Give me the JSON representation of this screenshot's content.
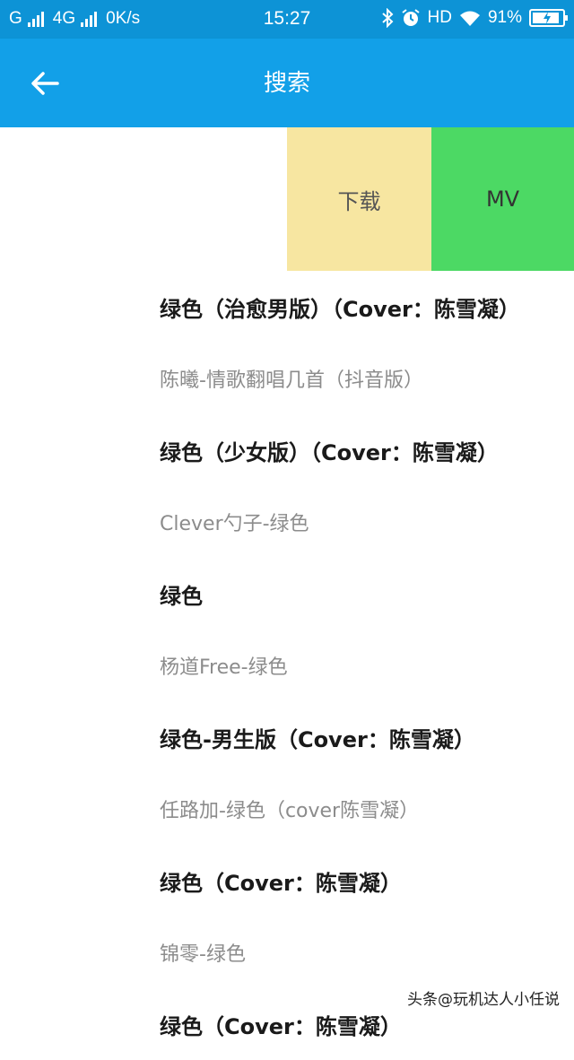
{
  "status_bar": {
    "carrier": "G",
    "network": "4G",
    "speed": "0K/s",
    "time": "15:27",
    "hd": "HD",
    "battery": "91%",
    "battery_level": 0.91,
    "icons": [
      "signal-icon",
      "bluetooth-icon",
      "alarm-icon",
      "wifi-icon",
      "battery-icon"
    ]
  },
  "app_bar": {
    "title": "搜索",
    "back_icon": "arrow-left-icon"
  },
  "swipe_actions": {
    "download_label": "下载",
    "mv_label": "MV",
    "download_color": "#f7e6a1",
    "mv_color": "#4cd964"
  },
  "results": [
    {
      "type": "song",
      "text": "绿色（治愈男版）（Cover：陈雪凝）"
    },
    {
      "type": "artist",
      "text": "陈曦-情歌翻唱几首（抖音版）"
    },
    {
      "type": "song",
      "text": "绿色（少女版）（Cover：陈雪凝）"
    },
    {
      "type": "artist",
      "text": "Clever勺子-绿色"
    },
    {
      "type": "song",
      "text": "绿色"
    },
    {
      "type": "artist",
      "text": "杨道Free-绿色"
    },
    {
      "type": "song",
      "text": "绿色-男生版（Cover：陈雪凝）"
    },
    {
      "type": "artist",
      "text": "任路加-绿色（cover陈雪凝）"
    },
    {
      "type": "song",
      "text": "绿色（Cover：陈雪凝）"
    },
    {
      "type": "artist",
      "text": "锦零-绿色"
    },
    {
      "type": "song",
      "text": "绿色（Cover：陈雪凝）"
    }
  ],
  "watermark": "头条@玩机达人小任说",
  "colors": {
    "status_bar": "#0d93d6",
    "app_bar": "#12a0e8"
  }
}
